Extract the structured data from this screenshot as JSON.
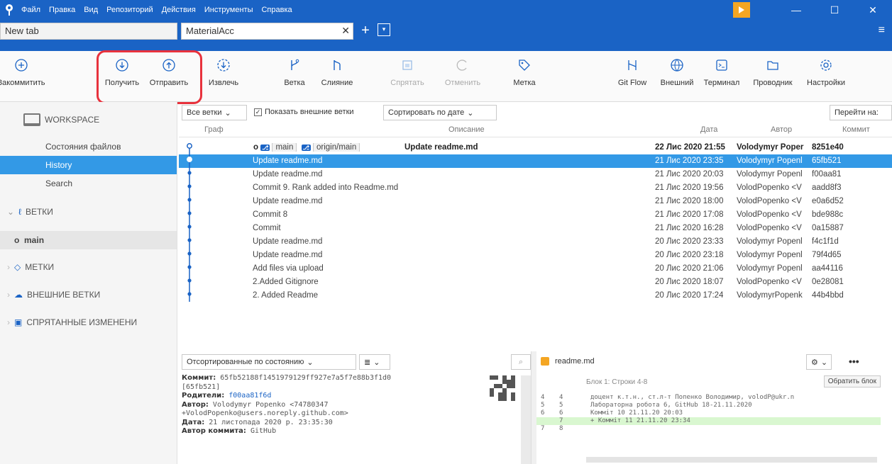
{
  "menu": [
    "Файл",
    "Правка",
    "Вид",
    "Репозиторий",
    "Действия",
    "Инструменты",
    "Справка"
  ],
  "tabs": {
    "new_tab": "New tab",
    "active_tab": "MaterialAcc"
  },
  "toolbar": {
    "commit": "Закоммитить",
    "pull": "Получить",
    "push": "Отправить",
    "fetch": "Извлечь",
    "branch": "Ветка",
    "merge": "Слияние",
    "stash": "Спрятать",
    "discard": "Отменить",
    "tag": "Метка",
    "gitflow": "Git Flow",
    "remote": "Внешний",
    "terminal": "Терминал",
    "explorer": "Проводник",
    "settings": "Настройки"
  },
  "sidebar": {
    "workspace": "WORKSPACE",
    "file_status": "Состояния файлов",
    "history": "History",
    "search": "Search",
    "branches": "ВЕТКИ",
    "branch_main": "main",
    "tags": "МЕТКИ",
    "remotes": "ВНЕШНИЕ ВЕТКИ",
    "stashes": "СПРЯТАННЫЕ ИЗМЕНЕНИ"
  },
  "filter": {
    "all_branches": "Все ветки",
    "show_remote": "Показать внешние ветки",
    "sort": "Сортировать по дате",
    "goto": "Перейти на:"
  },
  "columns": {
    "graph": "Граф",
    "description": "Описание",
    "date": "Дата",
    "author": "Автор",
    "commit": "Коммит"
  },
  "head": {
    "branch_label": "main",
    "remote_label": "origin/main"
  },
  "commits": [
    {
      "desc": "Update readme.md",
      "date": "22 Лис 2020 21:55",
      "author": "Volodymyr Poper",
      "hash": "8251e40"
    },
    {
      "desc": "Update readme.md",
      "date": "21 Лис 2020 23:35",
      "author": "Volodymyr Popenl",
      "hash": "65fb521"
    },
    {
      "desc": "Update readme.md",
      "date": "21 Лис 2020 20:03",
      "author": "Volodymyr Popenl",
      "hash": "f00aa81"
    },
    {
      "desc": "Commit 9. Rank added into Readme.md",
      "date": "21 Лис 2020 19:56",
      "author": "VolodPopenko <V",
      "hash": "aadd8f3"
    },
    {
      "desc": "Update readme.md",
      "date": "21 Лис 2020 18:00",
      "author": "VolodPopenko <V",
      "hash": "e0a6d52"
    },
    {
      "desc": "Commit 8",
      "date": "21 Лис 2020 17:08",
      "author": "VolodPopenko <V",
      "hash": "bde988c"
    },
    {
      "desc": "Commit",
      "date": "21 Лис 2020 16:28",
      "author": "VolodPopenko <V",
      "hash": "0a15887"
    },
    {
      "desc": "Update readme.md",
      "date": "20 Лис 2020 23:33",
      "author": "Volodymyr Popenl",
      "hash": "f4c1f1d"
    },
    {
      "desc": "Update readme.md",
      "date": "20 Лис 2020 23:18",
      "author": "Volodymyr Popenl",
      "hash": "79f4d65"
    },
    {
      "desc": "Add files via upload",
      "date": "20 Лис 2020 21:06",
      "author": "Volodymyr Popenl",
      "hash": "aa44116"
    },
    {
      "desc": "2.Added Gitignore",
      "date": "20 Лис 2020 18:07",
      "author": "VolodPopenko <V",
      "hash": "0e28081"
    },
    {
      "desc": "2. Added Readme",
      "date": "20 Лис 2020 17:24",
      "author": "VolodymyrPopenk",
      "hash": "44b4bbd"
    }
  ],
  "bottom_left": {
    "sort_by_status": "Отсортированные по состоянию"
  },
  "details": {
    "commit_label": "Коммит:",
    "commit_value": "65fb52188f1451979129ff927e7a5f7e88b3f1d0",
    "commit_short": "[65fb521]",
    "parents_label": "Родители:",
    "parents_value": "f00aa81f6d",
    "author_label": "Автор:",
    "author_value": "Volodymyr Popenko <74780347",
    "author_value2": "+VolodPopenko@users.noreply.github.com>",
    "date_label": "Дата:",
    "date_value": "21 листопада 2020 р. 23:35:30",
    "committer_label": "Автор коммита:",
    "committer_value": "GitHub"
  },
  "diff": {
    "file": "readme.md",
    "hunk_header": "Блок 1: Строки 4-8",
    "revert_hunk": "Обратить блок",
    "lines": [
      {
        "n1": "4",
        "n2": "4",
        "text": " доцент к.т.н., ст.л-т Попенко Володимир, volodP@ukr.n"
      },
      {
        "n1": "5",
        "n2": "5",
        "text": " Лабораторна робота 6, GitHub  18-21.11.2020"
      },
      {
        "n1": "6",
        "n2": "6",
        "text": " Комміт 10 21.11.20 20:03"
      },
      {
        "n1": "",
        "n2": "7",
        "text": "+ Комміт 11 21.11.20 23:34"
      },
      {
        "n1": "7",
        "n2": "8",
        "text": " "
      }
    ]
  }
}
